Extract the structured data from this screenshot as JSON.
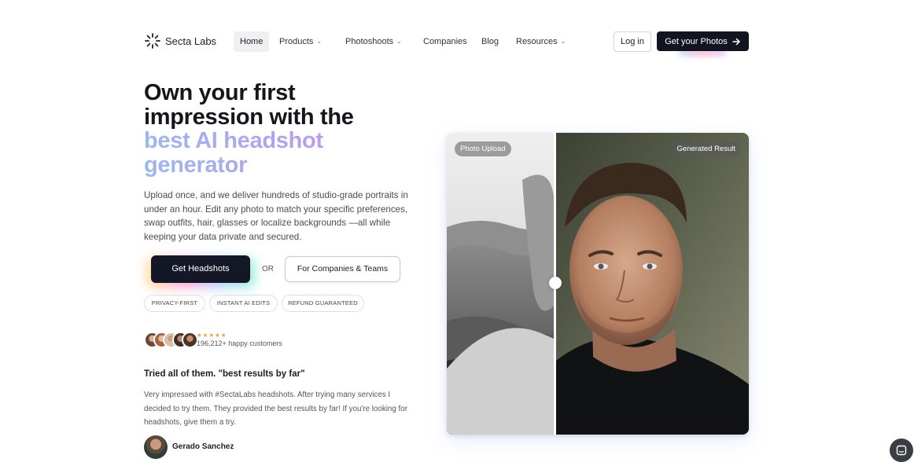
{
  "nav": {
    "logo_text": "Secta Labs",
    "links": [
      {
        "label": "Home",
        "has_dropdown": false
      },
      {
        "label": "Products",
        "has_dropdown": true
      },
      {
        "label": "Photoshoots",
        "has_dropdown": true
      },
      {
        "label": "Companies",
        "has_dropdown": false
      },
      {
        "label": "Blog",
        "has_dropdown": false
      },
      {
        "label": "Resources",
        "has_dropdown": true
      }
    ],
    "login_label": "Log in",
    "cta_label": "Get your Photos"
  },
  "hero": {
    "headline_line1": "Own your first",
    "headline_line2": "impression with the",
    "headline_highlight1": "best AI headshot",
    "headline_highlight2": "generator",
    "description": "Upload once, and we deliver hundreds of studio-grade portraits in under an hour. Edit any photo to match your specific preferences, swap outfits, hair, glasses or localize backgrounds —all while keeping your data private and secured.",
    "primary_button": "Get Headshots",
    "or_text": "OR",
    "secondary_button": "For Companies & Teams",
    "badges": [
      "PRIVACY-FIRST",
      "INSTANT AI EDITS",
      "REFUND GUARANTEED"
    ],
    "stars": "★★★★★",
    "customers_text": "196,212+ happy customers"
  },
  "testimonial": {
    "title": "Tried all of them. \"best results by far\"",
    "body": "Very impressed with #SectaLabs headshots. After trying many services I decided to try them. They provided the best results by far! If you're looking for headshots, give them a try.",
    "author": "Gerado Sanchez"
  },
  "comparison": {
    "left_label": "Photo Upload",
    "right_label": "Generated Result"
  },
  "colors": {
    "primary_dark": "#141726",
    "accent_blue": "#9ab8f0",
    "accent_purple": "#b59ef0",
    "star_color": "#f0a23a"
  }
}
